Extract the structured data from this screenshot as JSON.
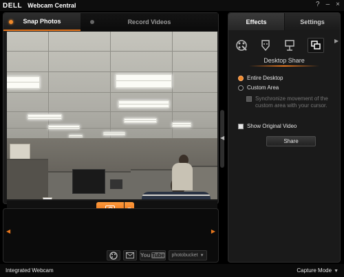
{
  "window": {
    "brand": "DELL",
    "title": "Webcam Central",
    "help_label": "?",
    "minimize_label": "–",
    "close_label": "×"
  },
  "left_tabs": [
    {
      "label": "Snap Photos"
    },
    {
      "label": "Record Videos"
    }
  ],
  "right_tabs": {
    "effects": "Effects",
    "settings": "Settings"
  },
  "effects_icons": [
    "effects-palette-icon",
    "face-tracking-icon",
    "presentation-easel-icon",
    "desktop-share-icon"
  ],
  "desktop_share": {
    "title": "Desktop Share",
    "entire_desktop": "Entire Desktop",
    "custom_area": "Custom Area",
    "sync_text": "Synchronize movement of the custom area with your cursor.",
    "show_original": "Show Original Video",
    "share_label": "Share"
  },
  "gallery_tools": {
    "youtube_you": "You",
    "youtube_tube": "Tube",
    "photobucket": "photobucket"
  },
  "status": {
    "device": "Integrated Webcam",
    "mode": "Capture Mode"
  },
  "colors": {
    "accent": "#e8771d",
    "background": "#000000",
    "panel": "#1a1a1a"
  }
}
